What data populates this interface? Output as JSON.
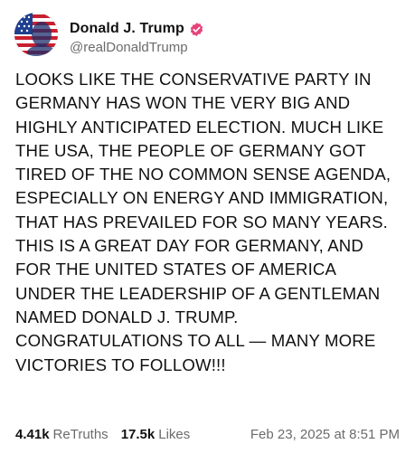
{
  "post": {
    "author": {
      "display_name": "Donald J. Trump",
      "handle": "@realDonaldTrump",
      "verified": true,
      "verified_color": "#e6427a"
    },
    "text": "LOOKS LIKE THE CONSERVATIVE PARTY  IN\nGERMANY HAS WON THE VERY BIG AND\nHIGHLY ANTICIPATED ELECTION. MUCH LIKE\nTHE USA, THE PEOPLE OF GERMANY GOT\nTIRED OF THE NO COMMON SENSE AGENDA,\nESPECIALLY ON ENERGY AND IMMIGRATION,\nTHAT HAS PREVAILED FOR SO MANY YEARS.\nTHIS IS A GREAT DAY FOR GERMANY, AND\nFOR THE UNITED STATES OF AMERICA\nUNDER THE LEADERSHIP OF A GENTLEMAN\nNAMED DONALD J. TRUMP.\nCONGRATULATIONS TO ALL — MANY MORE\nVICTORIES TO FOLLOW!!!",
    "stats": {
      "retruths_count": "4.41k",
      "retruths_label": "ReTruths",
      "likes_count": "17.5k",
      "likes_label": "Likes"
    },
    "timestamp": "Feb 23, 2025 at 8:51 PM"
  },
  "icons": {
    "avatar": "profile-avatar-flag",
    "verified": "verified-badge-icon"
  }
}
